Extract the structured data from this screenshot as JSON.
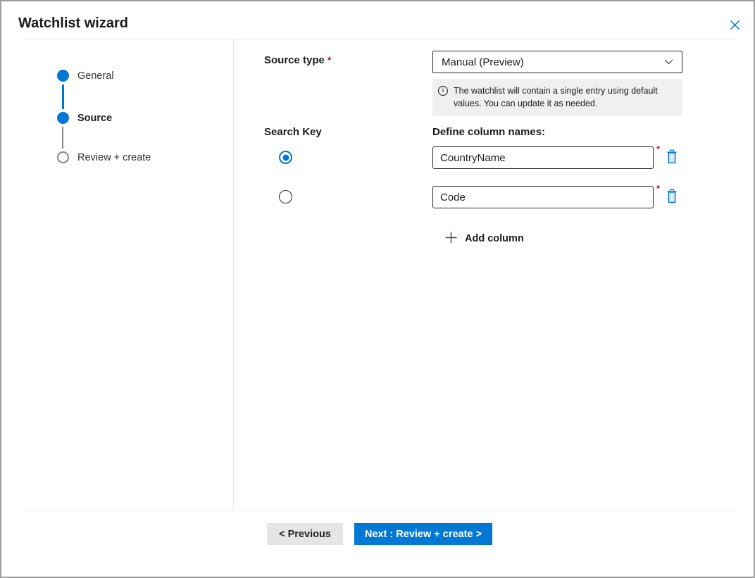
{
  "window": {
    "title": "Watchlist wizard"
  },
  "stepper": {
    "steps": [
      {
        "label": "General",
        "state": "completed"
      },
      {
        "label": "Source",
        "state": "current"
      },
      {
        "label": "Review + create",
        "state": "upcoming"
      }
    ]
  },
  "form": {
    "source_type": {
      "label": "Source type",
      "required_mark": "*",
      "selected_value": "Manual (Preview)",
      "info_text": "The watchlist will contain a single entry using default values. You can update it as needed."
    },
    "search_key_label": "Search Key",
    "define_columns_label": "Define column names:",
    "columns": [
      {
        "value": "CountryName",
        "required_mark": "*",
        "search_key_selected": true
      },
      {
        "value": "Code",
        "required_mark": "*",
        "search_key_selected": false
      }
    ],
    "add_column_label": "Add column"
  },
  "footer": {
    "previous_label": "< Previous",
    "next_label": "Next : Review + create >"
  },
  "icons": {
    "info_glyph": "i"
  },
  "colors": {
    "accent_blue": "#0078d4",
    "required_red": "#a4262c",
    "info_box_bg": "#f0f0f0",
    "secondary_button_bg": "#e5e5e5",
    "divider": "#eaeaea"
  }
}
